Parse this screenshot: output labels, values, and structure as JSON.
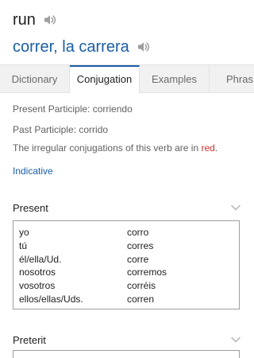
{
  "entry": {
    "word": "run",
    "translation_part1": "correr,",
    "translation_part2": "la carrera"
  },
  "icons": {
    "speaker": "speaker-icon",
    "chevron": "chevron-down-icon"
  },
  "tabs": [
    {
      "label": "Dictionary",
      "active": false
    },
    {
      "label": "Conjugation",
      "active": true
    },
    {
      "label": "Examples",
      "active": false
    },
    {
      "label": "Phras",
      "active": false
    }
  ],
  "info": {
    "present_participle": "Present Participle: corriendo",
    "past_participle": "Past Participle: corrido",
    "irregular_note_prefix": "The irregular conjugations of this verb are in ",
    "irregular_note_red": "red",
    "irregular_note_suffix": "."
  },
  "mood_link": "Indicative",
  "sections": [
    {
      "title": "Present",
      "rows": [
        {
          "pronoun": "yo",
          "form": "corro"
        },
        {
          "pronoun": "tú",
          "form": "corres"
        },
        {
          "pronoun": "él/ella/Ud.",
          "form": "corre"
        },
        {
          "pronoun": "nosotros",
          "form": "corremos"
        },
        {
          "pronoun": "vosotros",
          "form": "corréis"
        },
        {
          "pronoun": "ellos/ellas/Uds.",
          "form": "corren"
        }
      ]
    },
    {
      "title": "Preterit",
      "rows": []
    }
  ],
  "colors": {
    "link_blue": "#1a5fa6",
    "irregular_red": "#d32f2f",
    "tab_bar_bg": "#f1f1f1"
  }
}
